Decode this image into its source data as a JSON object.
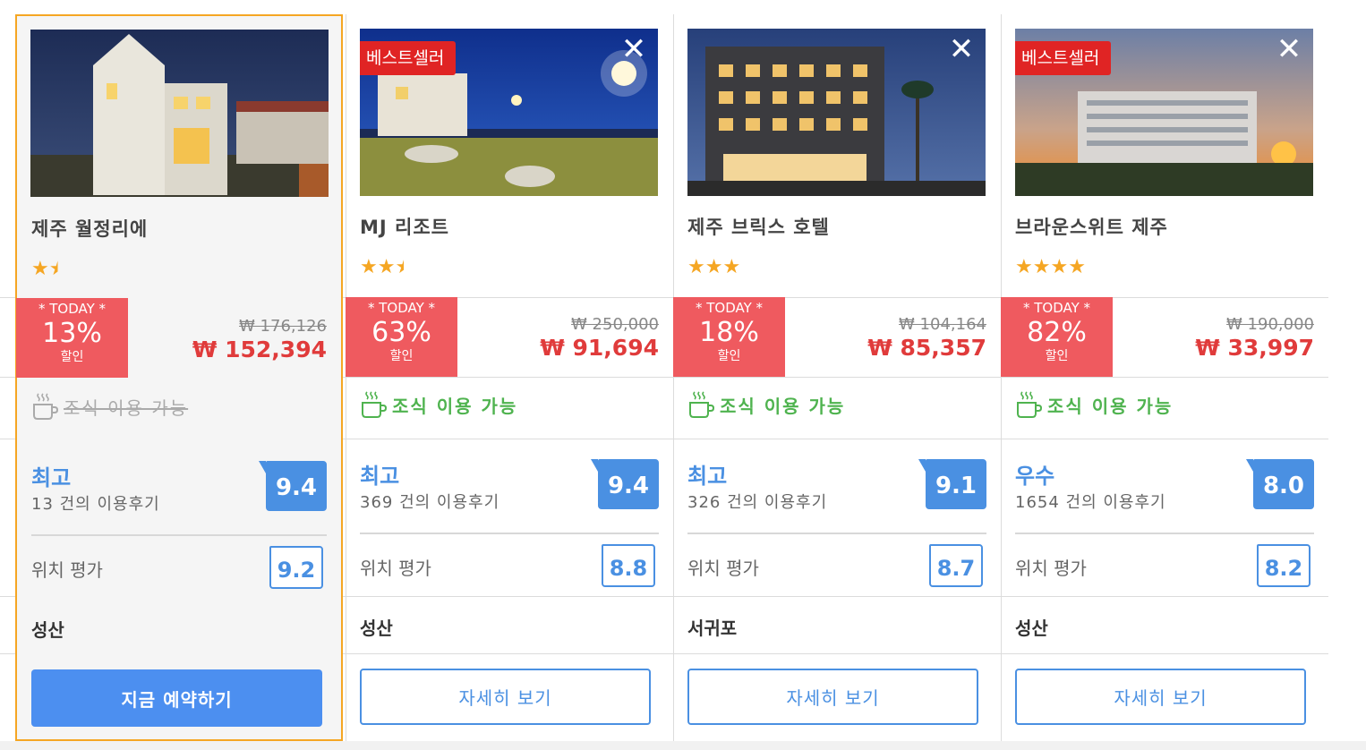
{
  "hotels": [
    {
      "name": "제주 월정리에",
      "selected": true,
      "bestseller": "",
      "stars": 1.5,
      "star_glyphs": "★",
      "deal": {
        "today": "* TODAY *",
        "percent": "13%",
        "off": "할인"
      },
      "original_price": "₩ 176,126",
      "price": "₩ 152,394",
      "breakfast": {
        "label": "조식 이용 가능",
        "available": false
      },
      "review": {
        "word": "최고",
        "count": "13 건의 이용후기",
        "score": "9.4"
      },
      "location": {
        "label": "위치 평가",
        "score": "9.2"
      },
      "area": "성산",
      "button": "지금 예약하기"
    },
    {
      "name": "MJ 리조트",
      "selected": false,
      "bestseller": "베스트셀러",
      "stars": 2.5,
      "deal": {
        "today": "* TODAY *",
        "percent": "63%",
        "off": "할인"
      },
      "original_price": "₩ 250,000",
      "price": "₩ 91,694",
      "breakfast": {
        "label": "조식 이용 가능",
        "available": true
      },
      "review": {
        "word": "최고",
        "count": "369 건의 이용후기",
        "score": "9.4"
      },
      "location": {
        "label": "위치 평가",
        "score": "8.8"
      },
      "area": "성산",
      "button": "자세히 보기"
    },
    {
      "name": "제주 브릭스 호텔",
      "selected": false,
      "bestseller": "",
      "stars": 3,
      "deal": {
        "today": "* TODAY *",
        "percent": "18%",
        "off": "할인"
      },
      "original_price": "₩ 104,164",
      "price": "₩ 85,357",
      "breakfast": {
        "label": "조식 이용 가능",
        "available": true
      },
      "review": {
        "word": "최고",
        "count": "326 건의 이용후기",
        "score": "9.1"
      },
      "location": {
        "label": "위치 평가",
        "score": "8.7"
      },
      "area": "서귀포",
      "button": "자세히 보기"
    },
    {
      "name": "브라운스위트 제주",
      "selected": false,
      "bestseller": "베스트셀러",
      "stars": 4,
      "deal": {
        "today": "* TODAY *",
        "percent": "82%",
        "off": "할인"
      },
      "original_price": "₩ 190,000",
      "price": "₩ 33,997",
      "breakfast": {
        "label": "조식 이용 가능",
        "available": true
      },
      "review": {
        "word": "우수",
        "count": "1654 건의 이용후기",
        "score": "8.0"
      },
      "location": {
        "label": "위치 평가",
        "score": "8.2"
      },
      "area": "성산",
      "button": "자세히 보기"
    }
  ],
  "close_glyph": "✕",
  "colors": {
    "accent_blue": "#4a90e2",
    "deal_red": "#ef5a5f",
    "price_red": "#e03b3b",
    "breakfast_green": "#4fb34f",
    "star_orange": "#f5a623",
    "selected_border": "#f5a623",
    "bestseller_red": "#e02424"
  }
}
